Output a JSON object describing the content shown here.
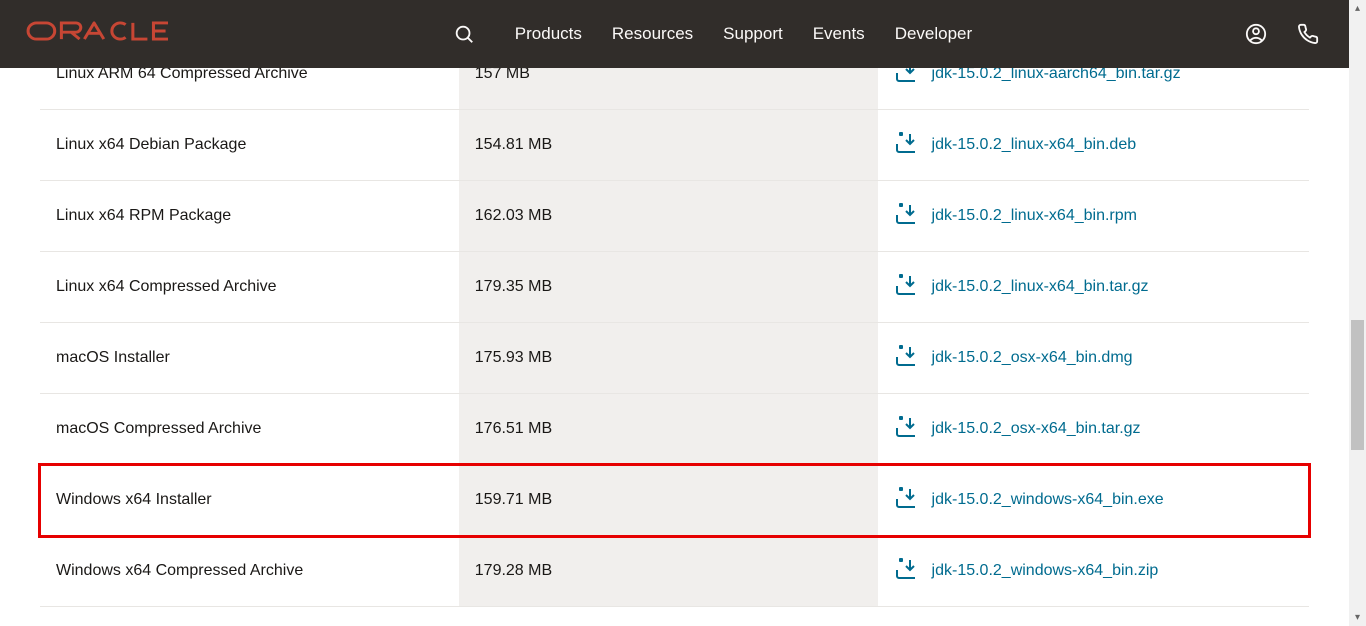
{
  "header": {
    "brand": "ORACLE",
    "nav": {
      "products": "Products",
      "resources": "Resources",
      "support": "Support",
      "events": "Events",
      "developer": "Developer"
    }
  },
  "downloads": [
    {
      "name": "Linux ARM 64 Compressed Archive",
      "size": "157 MB",
      "file": "jdk-15.0.2_linux-aarch64_bin.tar.gz",
      "highlight": false
    },
    {
      "name": "Linux x64 Debian Package",
      "size": "154.81 MB",
      "file": "jdk-15.0.2_linux-x64_bin.deb",
      "highlight": false
    },
    {
      "name": "Linux x64 RPM Package",
      "size": "162.03 MB",
      "file": "jdk-15.0.2_linux-x64_bin.rpm",
      "highlight": false
    },
    {
      "name": "Linux x64 Compressed Archive",
      "size": "179.35 MB",
      "file": "jdk-15.0.2_linux-x64_bin.tar.gz",
      "highlight": false
    },
    {
      "name": "macOS Installer",
      "size": "175.93 MB",
      "file": "jdk-15.0.2_osx-x64_bin.dmg",
      "highlight": false
    },
    {
      "name": "macOS Compressed Archive",
      "size": "176.51 MB",
      "file": "jdk-15.0.2_osx-x64_bin.tar.gz",
      "highlight": false
    },
    {
      "name": "Windows x64 Installer",
      "size": "159.71 MB",
      "file": "jdk-15.0.2_windows-x64_bin.exe",
      "highlight": true
    },
    {
      "name": "Windows x64 Compressed Archive",
      "size": "179.28 MB",
      "file": "jdk-15.0.2_windows-x64_bin.zip",
      "highlight": false
    }
  ]
}
